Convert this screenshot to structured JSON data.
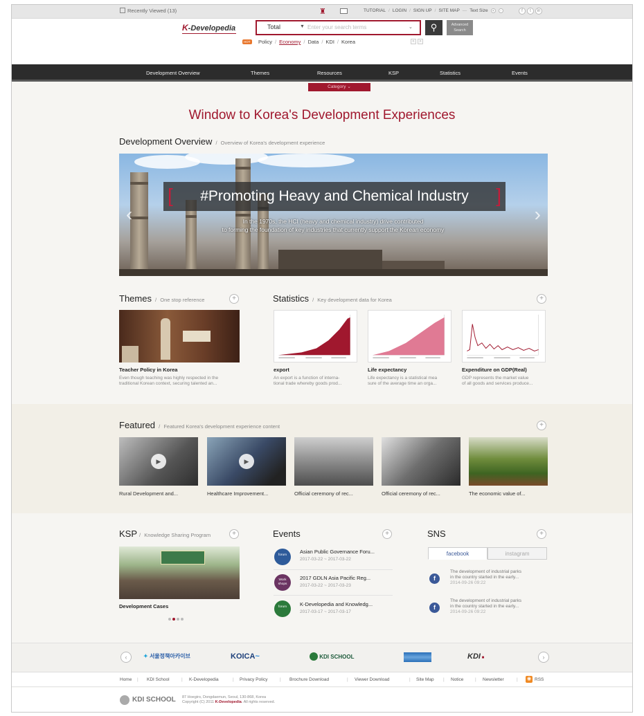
{
  "topbar": {
    "recently_viewed": "Recently Viewed (13)",
    "links": [
      "TUTORIAL",
      "LOGIN",
      "SIGN UP",
      "SITE MAP"
    ],
    "text_size_label": "Text Size",
    "social_icons": [
      "facebook-icon",
      "twitter-icon",
      "linkedin-icon"
    ]
  },
  "header": {
    "logo_k": "K",
    "logo_rest": "-Developedia",
    "search_category": "Total",
    "search_placeholder": "Enter your search terms",
    "advanced_line1": "Advanced",
    "advanced_line2": "Search",
    "hot_badge": "HOT",
    "keywords": [
      "Policy",
      "Economy",
      "Data",
      "KDI",
      "Korea"
    ],
    "active_keyword": "Economy"
  },
  "nav": {
    "items": [
      "Development Overview",
      "Themes",
      "Resources",
      "KSP",
      "Statistics",
      "Events"
    ],
    "category_label": "Category"
  },
  "hero": {
    "title": "Window to Korea's Development Experiences"
  },
  "overview": {
    "title": "Development Overview",
    "subtitle": "Overview of Korea's development experience",
    "banner_title": "#Promoting Heavy and Chemical Industry",
    "banner_line1": "In the 1970s, the HCI (heavy and chemical industry) drive contributed",
    "banner_line2": "to forming the foundation of key industries that currently support the Korean economy"
  },
  "themes": {
    "title": "Themes",
    "subtitle": "One stop reference",
    "item_title": "Teacher Policy in Korea",
    "item_desc_1": "Even though teaching was highly respected in the",
    "item_desc_2": "traditional Korean context, securing talented an..."
  },
  "statistics": {
    "title": "Statistics",
    "subtitle": "Key development data for Korea",
    "cards": [
      {
        "title": "export",
        "desc1": "An export is a function of interna-",
        "desc2": "tional trade whereby goods prod..."
      },
      {
        "title": "Life expectancy",
        "desc1": "Life expectancy is a statistical mea",
        "desc2": "sure of the average time an orga..."
      },
      {
        "title": "Expenditure on GDP(Real)",
        "desc1": "GDP represents the market value",
        "desc2": "of all goods and services produce..."
      }
    ]
  },
  "featured": {
    "title": "Featured",
    "subtitle": "Featured Korea's development experience content",
    "items": [
      "Rural Development and...",
      "Healthcare Improvement...",
      "Official ceremony of rec...",
      "Official ceremony of rec...",
      "The economic value of..."
    ]
  },
  "ksp": {
    "title": "KSP",
    "subtitle": "Knowledge Sharing Program",
    "caption": "Development Cases",
    "slides": 4,
    "active_slide": 2
  },
  "events": {
    "title": "Events",
    "items": [
      {
        "badge1": "forum",
        "badge2": "",
        "color": "#2e5b9a",
        "title": "Asian Public Governance Foru...",
        "date": "2017-03-22 ~ 2017-03-22"
      },
      {
        "badge1": "Work",
        "badge2": "shops",
        "color": "#6b3462",
        "title": "2017 GDLN Asia Pacific Reg...",
        "date": "2017-03-22 ~ 2017-03-23"
      },
      {
        "badge1": "forum",
        "badge2": "",
        "color": "#2b7a3b",
        "title": "K-Developedia and Knowledg...",
        "date": "2017-03-17 ~ 2017-03-17"
      }
    ]
  },
  "sns": {
    "title": "SNS",
    "tabs": [
      "facebook",
      "instagram"
    ],
    "posts": [
      {
        "line1": "The development of industrial parks",
        "line2": "in the country started in the early...",
        "date": "2014-09-26 09:22"
      },
      {
        "line1": "The development of industrial parks",
        "line2": "in the country started in the early...",
        "date": "2014-09-26 09:22"
      }
    ]
  },
  "partners": [
    "서울정책아카이브",
    "KOICA",
    "KDI SCHOOL",
    "KDI"
  ],
  "footer": {
    "links": [
      "Home",
      "KDI School",
      "K-Developedia",
      "Privacy Policy",
      "Brochure Download",
      "Viewer Download",
      "Site Map",
      "Notice",
      "Newsletter",
      "RSS"
    ],
    "logo": "KDI SCHOOL",
    "address": "87 Hoegiro, Dongdaemun, Seoul, 130-868, Korea",
    "copyright_pre": "Copyright (C) 2011",
    "copyright_brand": "K-Developedia",
    "copyright_post": ". All rights reserved."
  },
  "colors": {
    "brand": "#a0182e",
    "nav": "#2c2c2c",
    "page_bg": "#f6f5f2"
  }
}
